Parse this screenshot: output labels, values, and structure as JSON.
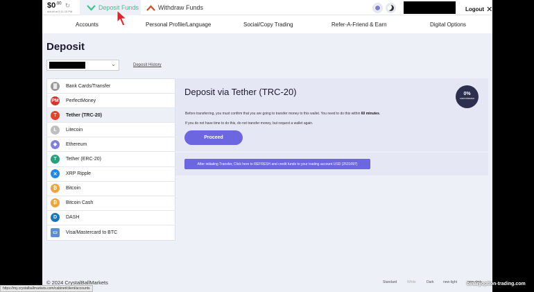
{
  "topbar": {
    "balance_main": "$0",
    "balance_cents": ".00",
    "balance_time": "actual at 5:11:15 PM",
    "tab_deposit": "Deposit Funds",
    "tab_withdraw": "Withdraw Funds",
    "logout": "Logout"
  },
  "nav": {
    "items": [
      "Accounts",
      "Personal Profile/Language",
      "Social/Copy Trading",
      "Refer-A-Friend & Earn",
      "Digital Options"
    ]
  },
  "deposit": {
    "heading": "Deposit",
    "history_link": "Deposit History",
    "methods": [
      {
        "label": "Bank Cards/Transfer",
        "icon": "bank-icon",
        "color": "#9a9a9a"
      },
      {
        "label": "PerfectMoney",
        "icon": "perfectmoney-icon",
        "color": "#d9342b"
      },
      {
        "label": "Tether (TRC-20)",
        "icon": "tether-trc20-icon",
        "color": "#e0452c"
      },
      {
        "label": "Litecoin",
        "icon": "litecoin-icon",
        "color": "#bdbdbd"
      },
      {
        "label": "Ethereum",
        "icon": "ethereum-icon",
        "color": "#7f7fe0"
      },
      {
        "label": "Tether (ERC-20)",
        "icon": "tether-erc20-icon",
        "color": "#26a17b"
      },
      {
        "label": "XRP Ripple",
        "icon": "xrp-icon",
        "color": "#1e88e5"
      },
      {
        "label": "Bitcoin",
        "icon": "bitcoin-icon",
        "color": "#f2a13b"
      },
      {
        "label": "Bitcoin Cash",
        "icon": "bitcoin-cash-icon",
        "color": "#f2a13b"
      },
      {
        "label": "DASH",
        "icon": "dash-icon",
        "color": "#1c75bc"
      },
      {
        "label": "Visa/Mastercard to BTC",
        "icon": "card-icon",
        "color": "#5b8fd4"
      }
    ],
    "active_index": 2
  },
  "panel": {
    "title": "Deposit via Tether (TRC-20)",
    "commission_value": "0%",
    "commission_label": "commission",
    "text1_prefix": "Before transferring, you must confirm that you are going to transfer money to this wallet. You need to do this within ",
    "text1_bold": "60 minutes",
    "text1_suffix": ".",
    "text2": "If you do not have time to do this, do not transfer money, but request a wallet again.",
    "proceed": "Proceed",
    "refresh_button": "After initiating Transfer, Click here to REFRESH and credit funds to your trading account USD (2531097)"
  },
  "footer": {
    "copyright": "© 2024 CrystalBallMarkets",
    "themes": [
      "Standard",
      "White",
      "Dark",
      "new-light",
      "new-dark"
    ]
  },
  "status_url": "https://my.crystalballmarkets.com/cabinet/client/accounts",
  "watermark": "binaryoption-trading.com",
  "colors": {
    "accent": "#6c66e0",
    "deposit_green": "#3cc48e",
    "withdraw_red": "#e0452c",
    "commission_badge": "#2d2f4e"
  }
}
